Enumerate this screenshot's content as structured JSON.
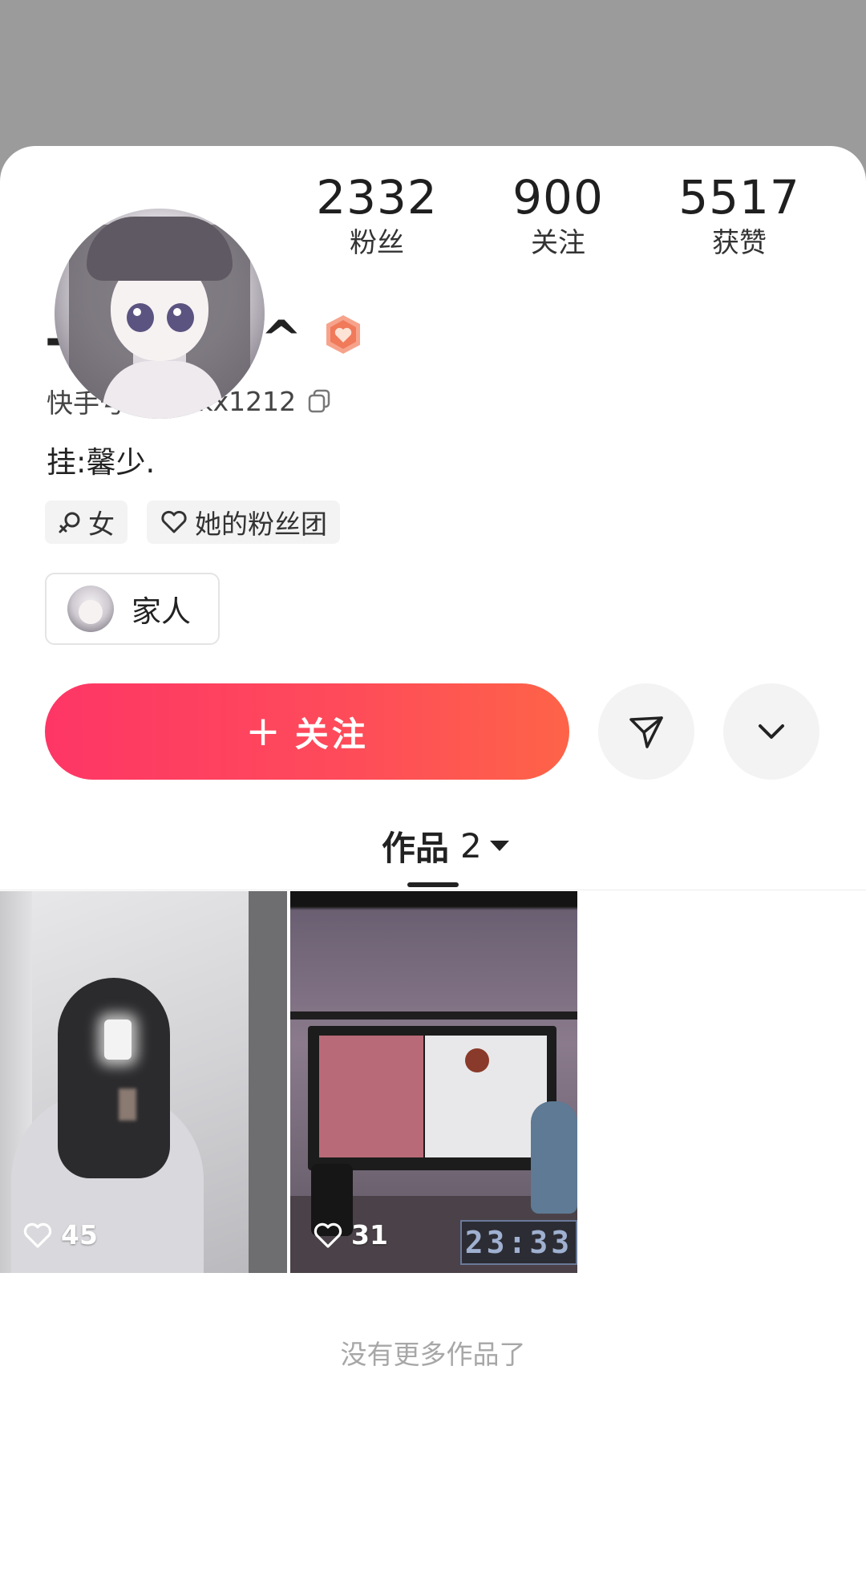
{
  "profile": {
    "nickname": "-小 不点.^",
    "kuaishou_id_label": "快手号:",
    "kuaishou_id": "ZJYttkx1212",
    "bio": "挂:馨少.",
    "stats": {
      "fans": {
        "value": "2332",
        "label": "粉丝"
      },
      "following": {
        "value": "900",
        "label": "关注"
      },
      "likes": {
        "value": "5517",
        "label": "获赞"
      }
    },
    "tags": [
      {
        "icon": "female-icon",
        "label": "女"
      },
      {
        "icon": "heart-outline-icon",
        "label": "她的粉丝团"
      }
    ],
    "family": {
      "label": "家人"
    }
  },
  "actions": {
    "follow_plus": "+",
    "follow_label": "关注",
    "share_icon": "send-icon",
    "more_icon": "chevron-down-icon"
  },
  "tabs": {
    "works_label": "作品",
    "works_count": "2"
  },
  "works": [
    {
      "likes": "45"
    },
    {
      "likes": "31",
      "clock_text": "23:33"
    }
  ],
  "footer": {
    "no_more": "没有更多作品了"
  },
  "colors": {
    "follow_gradient_start": "#fe3666",
    "follow_gradient_end": "#fe6348",
    "banner": "#9b9b9b",
    "badge": "#f07a5a"
  }
}
